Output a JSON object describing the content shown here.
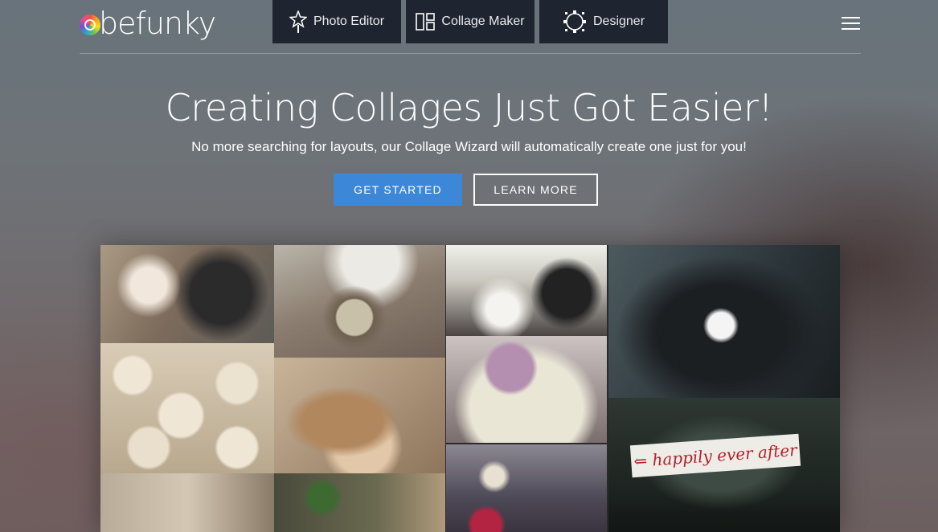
{
  "brand": {
    "logo_text": "befunky"
  },
  "nav": {
    "tabs": [
      {
        "label": "Photo Editor",
        "icon": "star-wand-icon"
      },
      {
        "label": "Collage Maker",
        "icon": "layout-grid-icon"
      },
      {
        "label": "Designer",
        "icon": "selection-circle-icon"
      }
    ],
    "menu_icon": "hamburger-menu-icon"
  },
  "hero": {
    "headline": "Creating Collages Just Got Easier!",
    "subheadline": "No more searching for layouts, our Collage Wizard will automatically create one just for you!",
    "primary_button": "GET STARTED",
    "secondary_button": "LEARN MORE"
  },
  "collage": {
    "sign_text": "happily ever after"
  },
  "colors": {
    "nav_background": "#1f2530",
    "primary_button": "#3d87d8",
    "sign_text": "#b5212b"
  }
}
